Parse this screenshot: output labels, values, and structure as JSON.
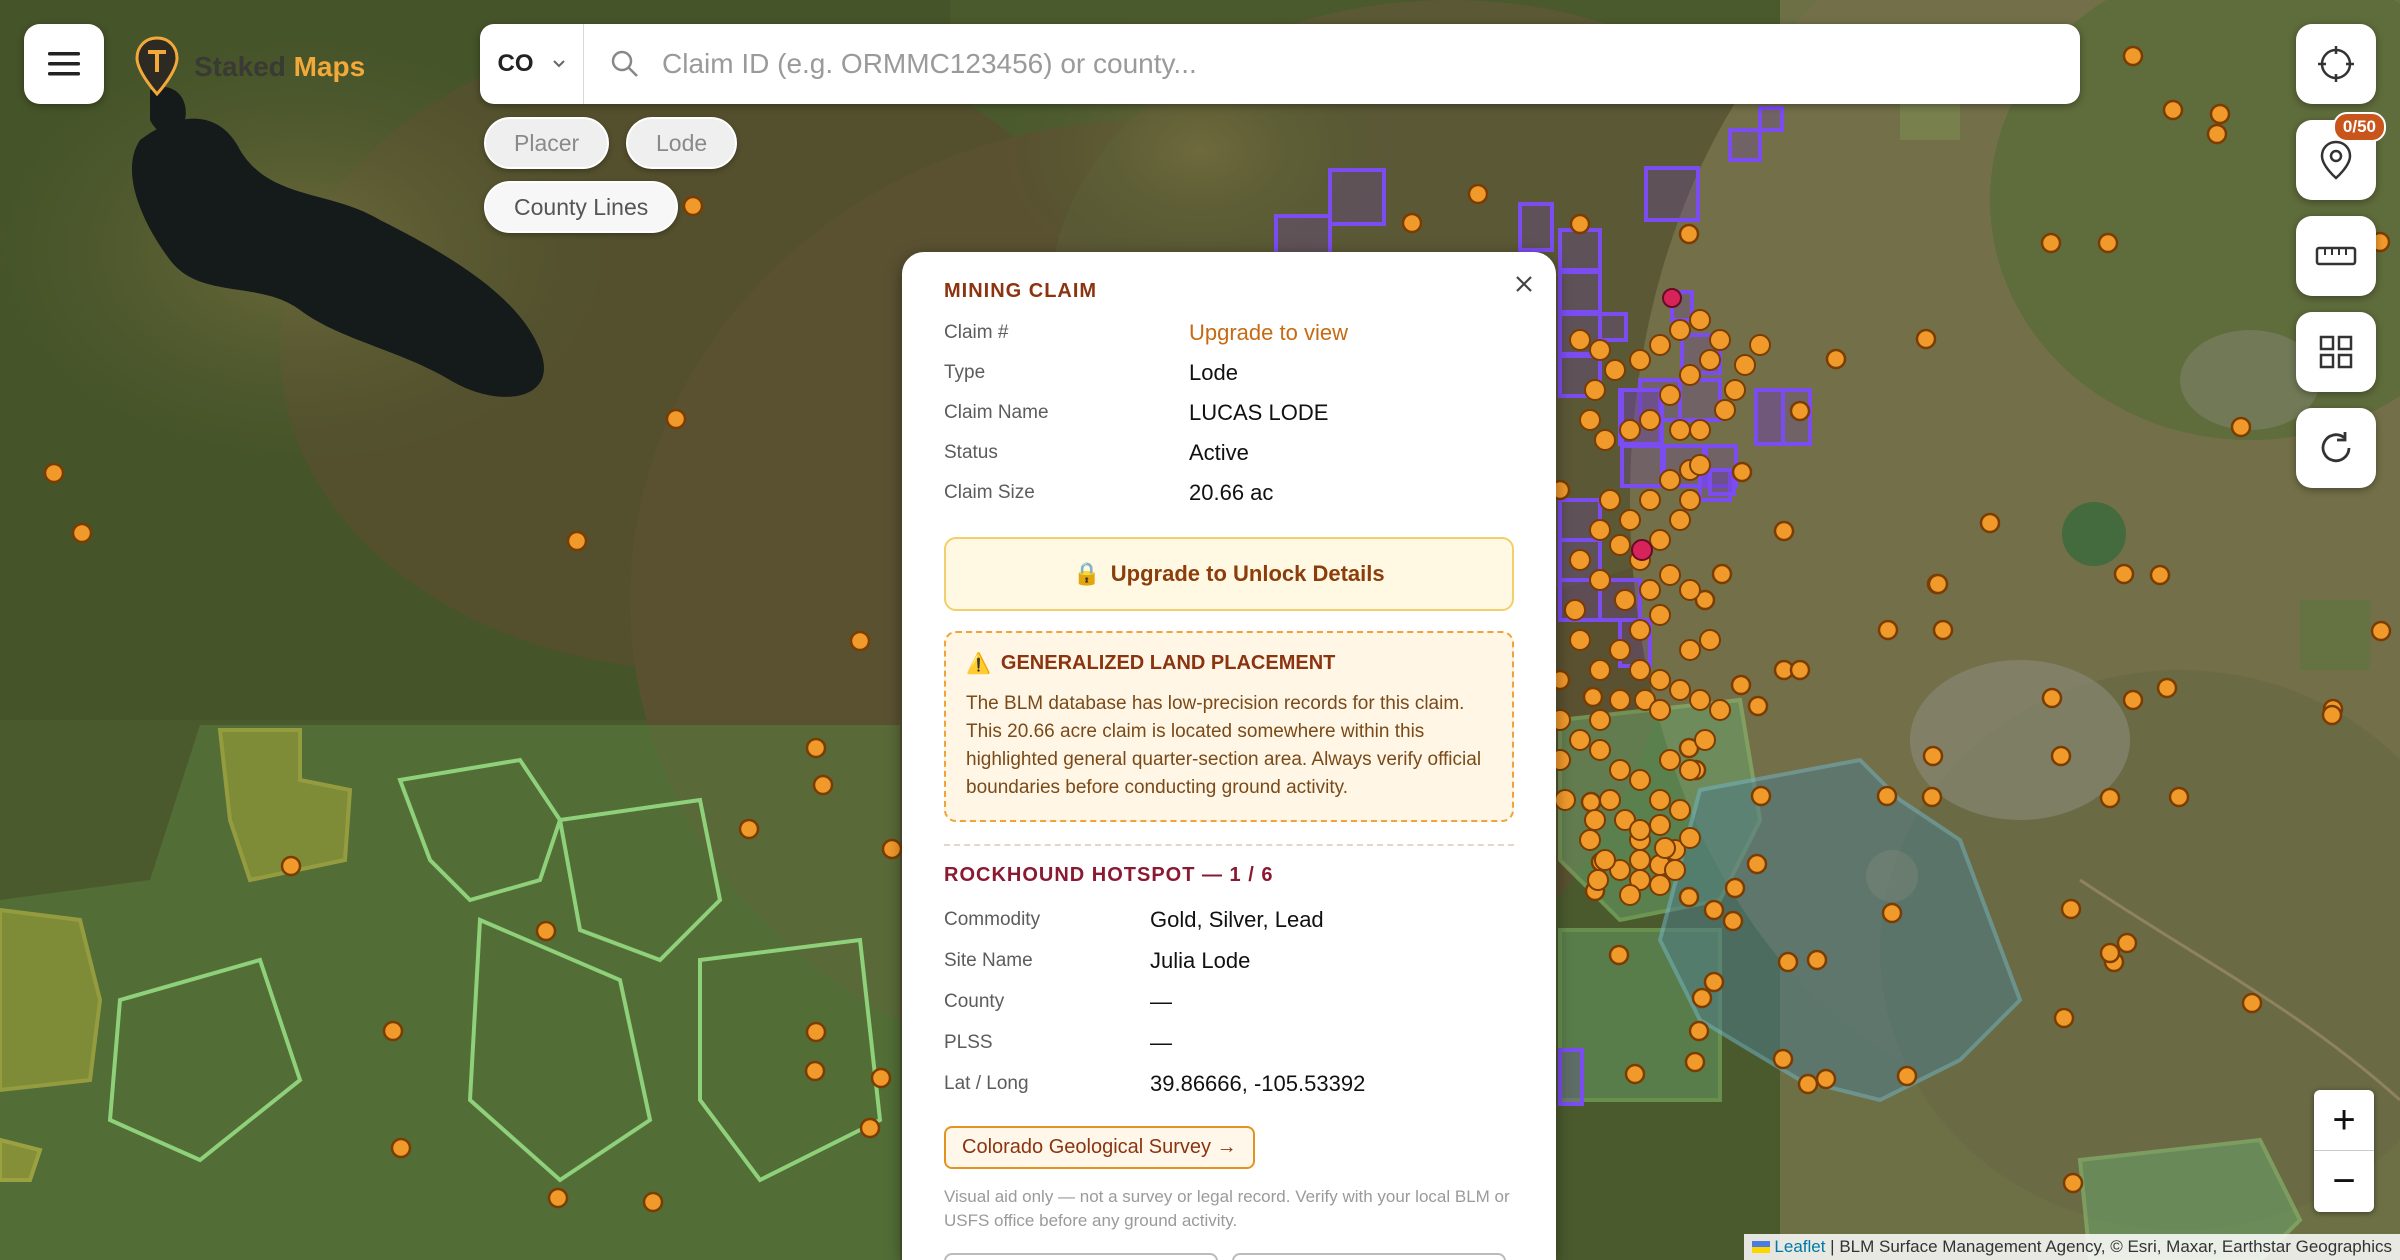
{
  "logo": {
    "word1": "Staked",
    "word2": "Maps"
  },
  "search": {
    "state": "CO",
    "placeholder": "Claim ID (e.g. ORMMC123456) or county..."
  },
  "chips": {
    "placer": "Placer",
    "lode": "Lode",
    "county_lines": "County Lines"
  },
  "toolbar": {
    "pin_badge": "0/50"
  },
  "zoom": {
    "in": "+",
    "out": "−"
  },
  "attribution": {
    "leaflet": "Leaflet",
    "rest": " | BLM Surface Management Agency, © Esri, Maxar, Earthstar Geographics"
  },
  "popup": {
    "claim_title": "MINING CLAIM",
    "claim_rows": [
      {
        "label": "Claim #",
        "value": "Upgrade to view"
      },
      {
        "label": "Type",
        "value": "Lode"
      },
      {
        "label": "Claim Name",
        "value": "LUCAS LODE"
      },
      {
        "label": "Status",
        "value": "Active"
      },
      {
        "label": "Claim Size",
        "value": "20.66 ac"
      }
    ],
    "unlock": {
      "icon": "🔒",
      "label": "Upgrade to Unlock Details"
    },
    "warning": {
      "icon": "⚠️",
      "title": "GENERALIZED LAND PLACEMENT",
      "body": "The BLM database has low-precision records for this claim. This 20.66 acre claim is located somewhere within this highlighted general quarter-section area. Always verify official boundaries before conducting ground activity."
    },
    "hotspot_title": "ROCKHOUND HOTSPOT — 1 / 6",
    "hotspot_rows": [
      {
        "label": "Commodity",
        "value": "Gold, Silver, Lead"
      },
      {
        "label": "Site Name",
        "value": "Julia Lode"
      },
      {
        "label": "County",
        "value": "—"
      },
      {
        "label": "PLSS",
        "value": "—"
      },
      {
        "label": "Lat / Long",
        "value": "39.86666, -105.53392"
      }
    ],
    "source_button": "Colorado Geological Survey →",
    "disclaimer": "Visual aid only — not a survey or legal record. Verify with your local BLM or USFS office before any ground activity."
  }
}
